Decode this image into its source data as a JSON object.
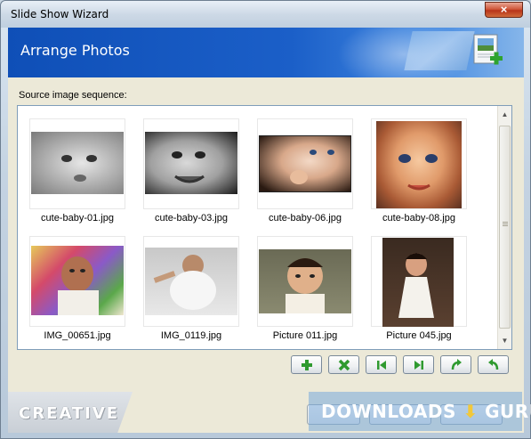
{
  "window": {
    "title": "Slide Show Wizard",
    "close_label": "×"
  },
  "header": {
    "title": "Arrange Photos",
    "icon": "add-photo-icon"
  },
  "list": {
    "label": "Source image sequence:",
    "items": [
      {
        "filename": "cute-baby-01.jpg"
      },
      {
        "filename": "cute-baby-03.jpg"
      },
      {
        "filename": "cute-baby-06.jpg"
      },
      {
        "filename": "cute-baby-08.jpg"
      },
      {
        "filename": "IMG_00651.jpg"
      },
      {
        "filename": "IMG_0119.jpg"
      },
      {
        "filename": "Picture 011.jpg"
      },
      {
        "filename": "Picture 045.jpg"
      }
    ]
  },
  "toolbar": {
    "buttons": [
      {
        "icon": "add-icon"
      },
      {
        "icon": "remove-icon"
      },
      {
        "icon": "move-first-icon"
      },
      {
        "icon": "move-last-icon"
      },
      {
        "icon": "rotate-right-icon"
      },
      {
        "icon": "rotate-left-icon"
      }
    ]
  },
  "footer": {
    "brand": "CREATIVE",
    "watermark_left": "DOWNLOADS",
    "watermark_right": "GURU"
  },
  "colors": {
    "header_blue": "#1b5fc8",
    "accent_green": "#2f9a2f"
  }
}
